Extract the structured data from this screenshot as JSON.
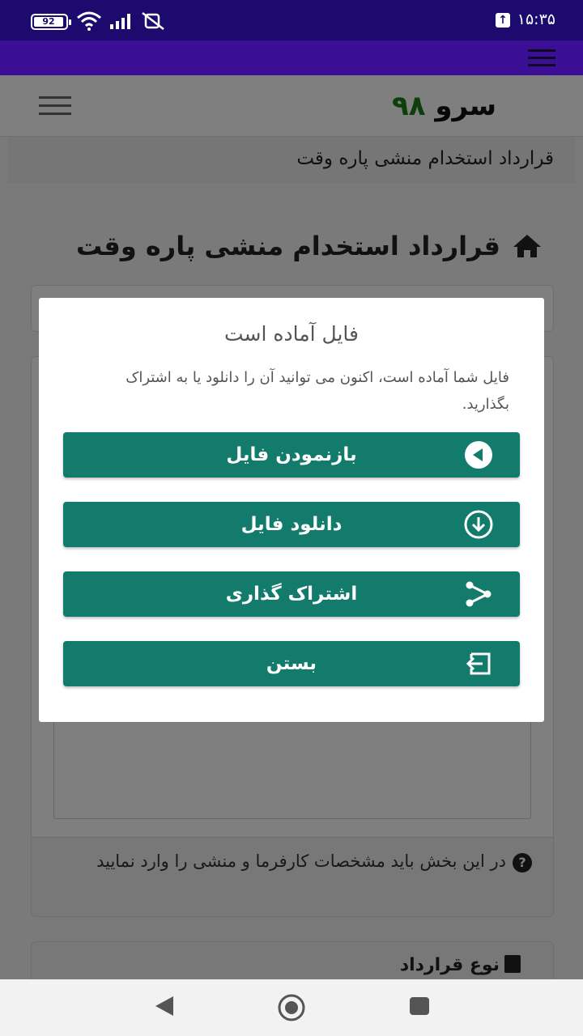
{
  "status_bar": {
    "battery": "92",
    "time": "۱۵:۳۵",
    "icons": [
      "battery-icon",
      "wifi-icon",
      "signal-icon",
      "mute-icon",
      "upload-icon"
    ]
  },
  "site": {
    "logo_text": "سرو",
    "logo_number": "۹۸",
    "menu_icon": "hamburger-icon"
  },
  "breadcrumb": "قرارداد استخدام منشی پاره وقت",
  "page_title": "قرارداد استخدام منشی پاره وقت",
  "help_text": "در این بخش باید مشخصات کارفرما و منشی را وارد نمایید",
  "contract_type_label": "نوع قرارداد",
  "modal": {
    "title": "فایل آماده است",
    "text": "فایل شما آماده است، اکنون می توانید آن را دانلود یا به اشتراک بگذارید.",
    "buttons": [
      {
        "label": "بازنمودن فایل",
        "icon": "open-file-icon"
      },
      {
        "label": "دانلود فایل",
        "icon": "download-icon"
      },
      {
        "label": "اشتراک گذاری",
        "icon": "share-icon"
      },
      {
        "label": "بستن",
        "icon": "exit-icon"
      }
    ]
  },
  "colors": {
    "status_bar": "#1c0a6e",
    "app_bar": "#3a0e95",
    "button": "#127b6c",
    "logo_green": "#1a7f1a"
  }
}
